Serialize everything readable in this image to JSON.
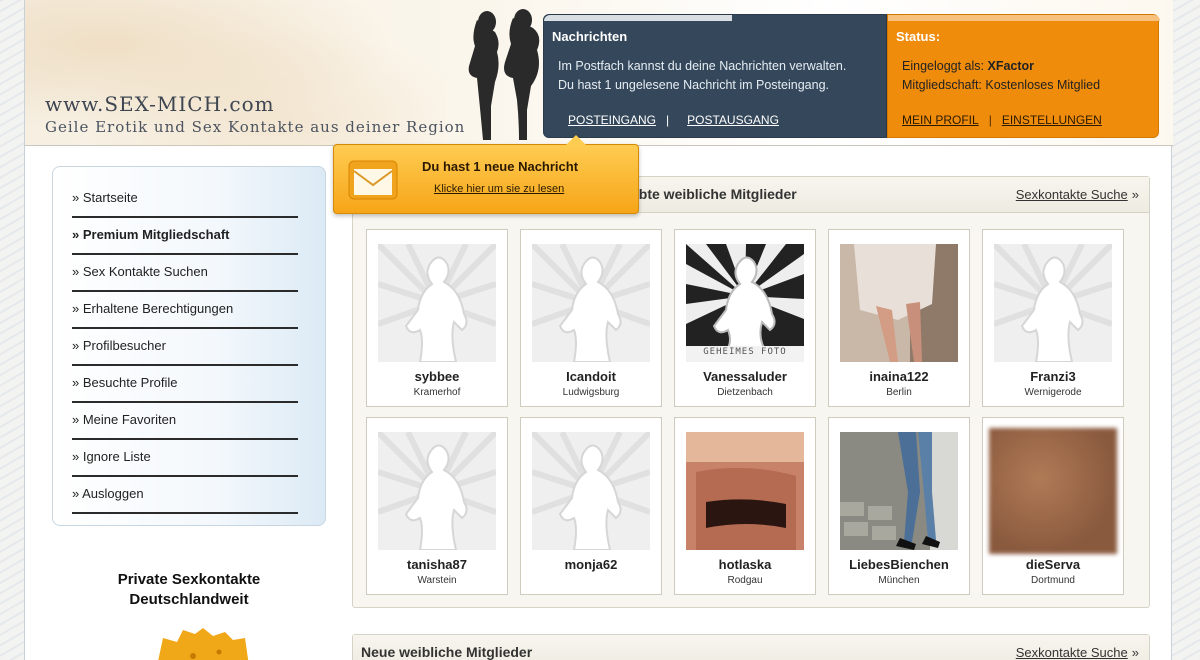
{
  "header": {
    "site_name": "www.SEX-MICH.com",
    "tagline": "Geile Erotik und Sex Kontakte aus deiner Region"
  },
  "messages_panel": {
    "title": "Nachrichten",
    "line1": "Im Postfach kannst du deine Nachrichten verwalten.",
    "line2": "Du hast 1 ungelesene Nachricht im Posteingang.",
    "inbox_link": "POSTEINGANG",
    "separator": "|",
    "outbox_link": "POSTAUSGANG"
  },
  "status_panel": {
    "title": "Status:",
    "logged_in_label": "Eingeloggt als:",
    "username": "XFactor",
    "membership_label": "Mitgliedschaft:",
    "membership_value": "Kostenloses Mitglied",
    "profile_link": "MEIN PROFIL",
    "separator": "|",
    "settings_link": "EINSTELLUNGEN"
  },
  "notification": {
    "title": "Du hast 1 neue Nachricht",
    "link": "Klicke hier um sie zu lesen"
  },
  "nav": {
    "items": [
      {
        "label": "» Startseite"
      },
      {
        "label": "» Premium Mitgliedschaft"
      },
      {
        "label": "» Sex Kontakte Suchen"
      },
      {
        "label": "» Erhaltene Berechtigungen"
      },
      {
        "label": "» Profilbesucher"
      },
      {
        "label": "» Besuchte Profile"
      },
      {
        "label": "» Meine Favoriten"
      },
      {
        "label": "» Ignore Liste"
      },
      {
        "label": "» Ausloggen"
      }
    ]
  },
  "private_box": {
    "title_line1": "Private Sexkontakte",
    "title_line2": "Deutschlandweit"
  },
  "sections": [
    {
      "title": "Beliebte weibliche Mitglieder",
      "visible_title": "ebte weibliche Mitglieder",
      "link": "Sexkontakte Suche",
      "link_arrow": "»"
    },
    {
      "title": "Neue weibliche Mitglieder",
      "link": "Sexkontakte Suche",
      "link_arrow": "»"
    }
  ],
  "members": [
    {
      "name": "sybbee",
      "city": "Kramerhof",
      "photo": "placeholder"
    },
    {
      "name": "Icandoit",
      "city": "Ludwigsburg",
      "photo": "placeholder"
    },
    {
      "name": "Vanessaluder",
      "city": "Dietzenbach",
      "photo": "secret",
      "photo_caption": "GEHEIMES FOTO"
    },
    {
      "name": "inaina122",
      "city": "Berlin",
      "photo": "legs-skirt"
    },
    {
      "name": "Franzi3",
      "city": "Wernigerode",
      "photo": "placeholder"
    },
    {
      "name": "tanisha87",
      "city": "Warstein",
      "photo": "placeholder"
    },
    {
      "name": "monja62",
      "city": "",
      "photo": "placeholder"
    },
    {
      "name": "hotlaska",
      "city": "Rodgau",
      "photo": "lingerie"
    },
    {
      "name": "LiebesBienchen",
      "city": "München",
      "photo": "jeans-heels"
    },
    {
      "name": "dieServa",
      "city": "Dortmund",
      "photo": "blurred"
    }
  ],
  "icons": {
    "envelope": "envelope-icon",
    "silhouette": "female-silhouette-icon"
  }
}
